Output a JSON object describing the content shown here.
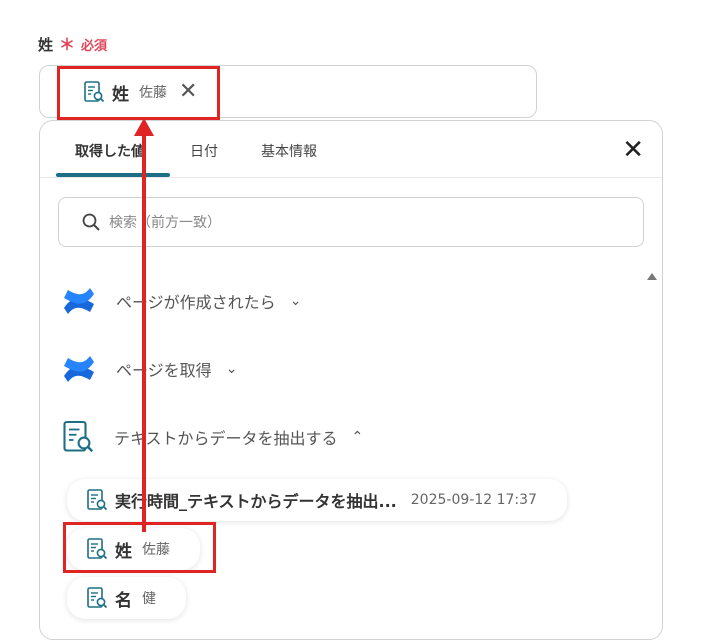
{
  "field": {
    "label": "姓",
    "required_mark": "＊",
    "required_text": "必須",
    "chip": {
      "label": "姓",
      "value": "佐藤",
      "close": "✕"
    }
  },
  "panel": {
    "tabs": [
      {
        "label": "取得した値",
        "active": true
      },
      {
        "label": "日付",
        "active": false
      },
      {
        "label": "基本情報",
        "active": false
      }
    ],
    "close": "✕",
    "search": {
      "placeholder": "検索（前方一致）"
    },
    "sections": [
      {
        "label": "ページが作成されたら",
        "icon": "confluence-icon",
        "expanded": false,
        "chevron": "⌄"
      },
      {
        "label": "ページを取得",
        "icon": "confluence-icon",
        "expanded": false,
        "chevron": "⌄"
      },
      {
        "label": "テキストからデータを抽出する",
        "icon": "document-search-icon",
        "expanded": true,
        "chevron": "⌃"
      }
    ],
    "items": [
      {
        "label": "実行時間_テキストからデータを抽出...",
        "value": "2025-09-12 17:37"
      },
      {
        "label": "姓",
        "value": "佐藤"
      },
      {
        "label": "名",
        "value": "健"
      }
    ]
  },
  "colors": {
    "accent": "#1d6f86",
    "required": "#e0475a",
    "annotation": "#e02424",
    "confluence": "#1868db"
  }
}
